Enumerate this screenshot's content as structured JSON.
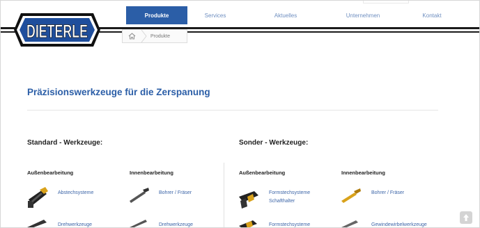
{
  "brand": {
    "logo_text": "DIETERLE"
  },
  "nav": {
    "items": [
      {
        "label": "Produkte",
        "active": true
      },
      {
        "label": "Services",
        "active": false
      },
      {
        "label": "Aktuelles",
        "active": false
      },
      {
        "label": "Unternehmen",
        "active": false
      },
      {
        "label": "Kontakt",
        "active": false
      }
    ]
  },
  "breadcrumb": {
    "home_icon": "home-icon",
    "current": "Produkte"
  },
  "page": {
    "title": "Präzisionswerkzeuge für die Zerspanung"
  },
  "standard": {
    "title": "Standard - Werkzeuge:",
    "aussen": {
      "heading": "Außenbearbeitung",
      "items": [
        {
          "label": "Abstechsysteme"
        },
        {
          "label": "Drehwerkzeuge"
        }
      ]
    },
    "innen": {
      "heading": "Innenbearbeitung",
      "items": [
        {
          "label": "Bohrer / Fräser"
        },
        {
          "label": "Drehwerkzeuge"
        }
      ]
    }
  },
  "sonder": {
    "title": "Sonder - Werkzeuge:",
    "aussen": {
      "heading": "Außenbearbeitung",
      "items": [
        {
          "label": "Formstechsysteme",
          "label2": "Schafthalter"
        },
        {
          "label": "Formstechsysteme"
        }
      ]
    },
    "innen": {
      "heading": "Innenbearbeitung",
      "items": [
        {
          "label": "Bohrer / Fräser"
        },
        {
          "label": "Gewindewirbelwerkzeuge"
        }
      ]
    }
  },
  "colors": {
    "accent": "#2b5ea7",
    "link": "#3d66a8",
    "logo_blue": "#1f4e9c",
    "gold": "#d9a21b"
  }
}
